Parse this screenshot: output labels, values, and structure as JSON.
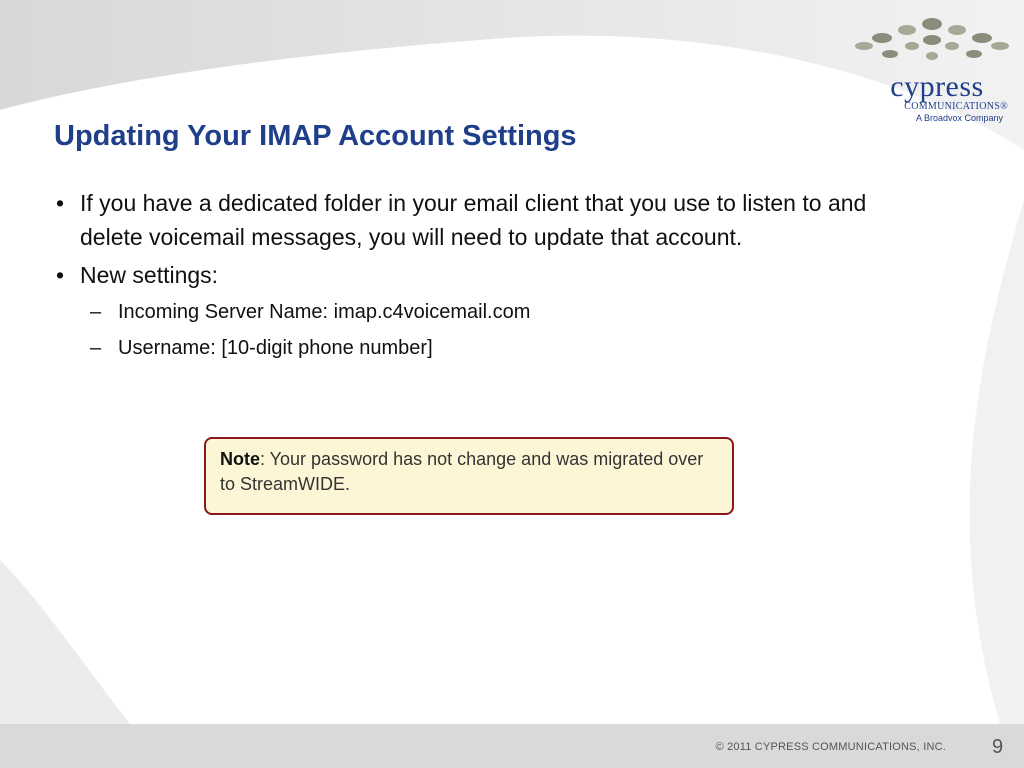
{
  "slide": {
    "title": "Updating Your IMAP Account Settings",
    "bullets": [
      {
        "text": "If you have a dedicated folder in your email client that you use to listen to and delete voicemail messages, you will need to update that account."
      },
      {
        "text": "New settings:",
        "sub": [
          "Incoming Server Name: imap.c4voicemail.com",
          "Username: [10-digit phone number]"
        ]
      }
    ],
    "note": {
      "label": "Note",
      "text": ": Your password has not change and was migrated over to StreamWIDE."
    }
  },
  "logo": {
    "name": "cypress",
    "sub": "COMMUNICATIONS®",
    "tagline": "A Broadvox Company",
    "dot_colors": [
      "#8c8c7a",
      "#a8a896"
    ]
  },
  "footer": {
    "copyright": "© 2011 CYPRESS COMMUNICATIONS, INC.",
    "page_number": "9"
  },
  "colors": {
    "title": "#1f3f8a",
    "note_border": "#8a1a1a",
    "note_fill": "#fdf6d6",
    "footer": "#d9d9d9"
  }
}
